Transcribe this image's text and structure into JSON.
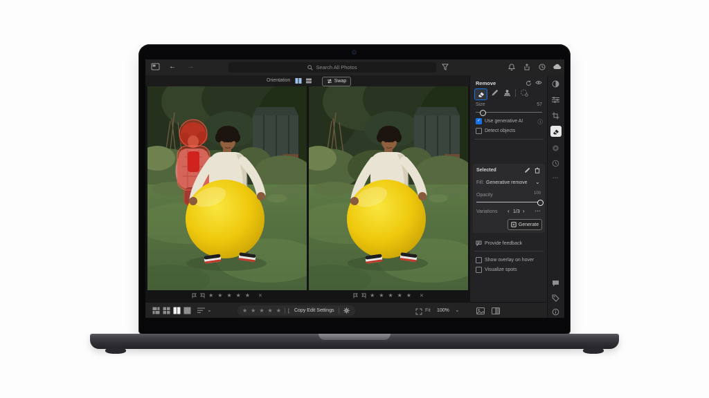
{
  "accent": "#1473e6",
  "top_bar": {
    "search_placeholder": "Search All Photos"
  },
  "compare_bar": {
    "orientation_label": "Orientation",
    "swap_label": "Swap"
  },
  "remove_panel": {
    "title": "Remove",
    "size_label": "Size",
    "size_value": "57",
    "use_generative_ai": "Use generative AI",
    "detect_objects": "Detect objects",
    "selected": {
      "title": "Selected",
      "fill_label": "Fill:",
      "fill_value": "Generative remove",
      "opacity_label": "Opacity",
      "opacity_value": "100",
      "variations_label": "Variations",
      "variations_value": "1/3",
      "generate_label": "Generate"
    },
    "provide_feedback": "Provide feedback",
    "show_overlay": "Show overlay on hover",
    "visualize_spots": "Visualize spots"
  },
  "bottom_bar": {
    "copy_edit_settings": "Copy Edit Settings",
    "fit_label": "Fit",
    "zoom_value": "100%"
  },
  "glyphs": {
    "star": "★",
    "back": "←",
    "forward": "→",
    "chevron_down": "⌄",
    "chevron_left": "‹",
    "chevron_right": "›",
    "more": "•••",
    "close": "✕",
    "check": "✓",
    "info": "ⓘ",
    "gear": "✱"
  }
}
